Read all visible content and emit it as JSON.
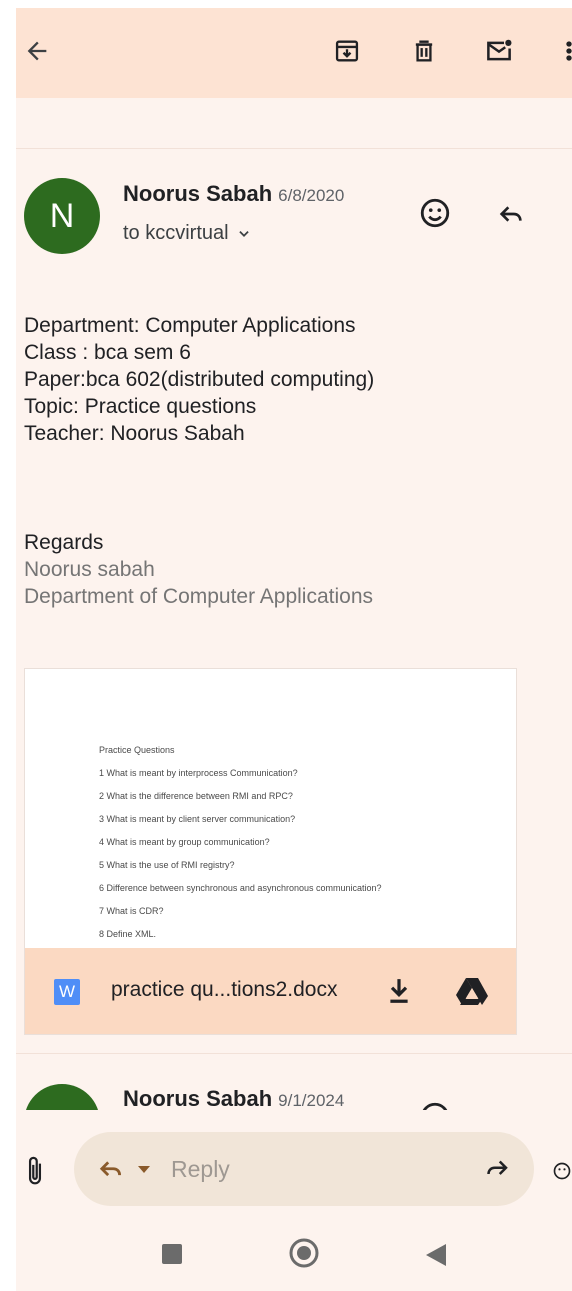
{
  "email1": {
    "avatar_letter": "N",
    "sender": "Noorus Sabah",
    "date": "6/8/2020",
    "recipient": "to kccvirtual",
    "body_lines": [
      "Department: Computer Applications",
      "Class : bca sem 6",
      "Paper:bca 602(distributed computing)",
      "Topic: Practice questions",
      "Teacher: Noorus Sabah"
    ],
    "signature": {
      "regards": "Regards",
      "name": "Noorus sabah",
      "dept": "Department of Computer Applications"
    },
    "attachment": {
      "preview_lines": [
        "Practice Questions",
        "1 What is meant by interprocess Communication?",
        "2 What is the difference between RMI and RPC?",
        "3 What is meant by client server communication?",
        "4 What is meant by group communication?",
        "5 What is the use of RMI registry?",
        "6 Difference between synchronous and asynchronous communication?",
        "7 What is CDR?",
        "8 Define XML."
      ],
      "type_icon_letter": "W",
      "filename": "practice qu...tions2.docx"
    }
  },
  "email2": {
    "sender": "Noorus Sabah",
    "date": "9/1/2024"
  },
  "composer": {
    "reply_placeholder": "Reply"
  },
  "colors": {
    "toolbar": "#fde3d3",
    "background": "#fdf3ee",
    "avatar": "#2d6b1f",
    "attachment_bar": "#fbd9c2",
    "word_icon": "#4f8ef7"
  }
}
